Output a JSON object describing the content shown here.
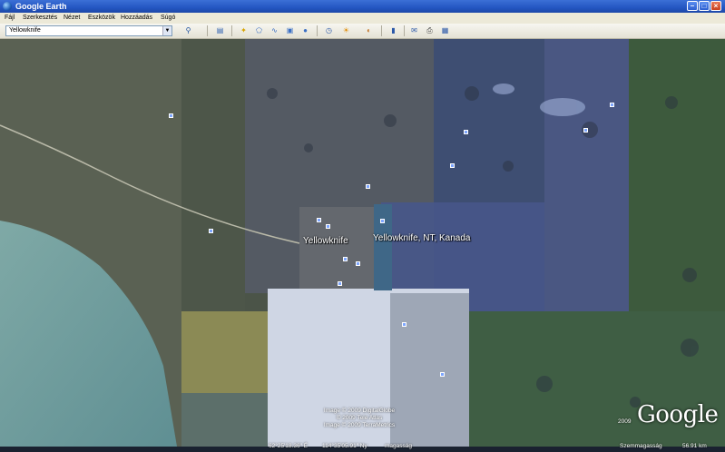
{
  "window": {
    "title": "Google Earth"
  },
  "menu": {
    "items": [
      "Fájl",
      "Szerkesztés",
      "Nézet",
      "Eszközök",
      "Hozzáadás",
      "Súgó"
    ]
  },
  "search": {
    "value": "Yellowknife"
  },
  "toolbar": {
    "icons": [
      "search-icon",
      "sidebar-icon",
      "placemark-icon",
      "polygon-icon",
      "path-icon",
      "image-overlay-icon",
      "record-tour-icon",
      "historical-imagery-icon",
      "sun-icon",
      "planets-icon",
      "ruler-icon",
      "email-icon",
      "print-icon",
      "view-in-maps-icon"
    ]
  },
  "map": {
    "place_label_city": "Yellowknife",
    "place_label_result": "Yellowknife, NT, Kanada",
    "copyright": [
      "Image © 2009 DigitalGlobe",
      "© 2009 Tele Atlas",
      "Image © 2009 TerraMetrics"
    ],
    "logo": "Google",
    "logo_year": "2009"
  },
  "status": {
    "lat": "62°25'18.36\" É",
    "lon": "114°35'05.91\" Ny",
    "elevation_label": "magasság",
    "elevation_value": "",
    "eye_alt_label": "Szemmagasság",
    "eye_alt_value": "56.91 km"
  },
  "colors": {
    "titlebar": "#2456c2",
    "menubar": "#ece9d8",
    "pin": "#7da6ff"
  }
}
